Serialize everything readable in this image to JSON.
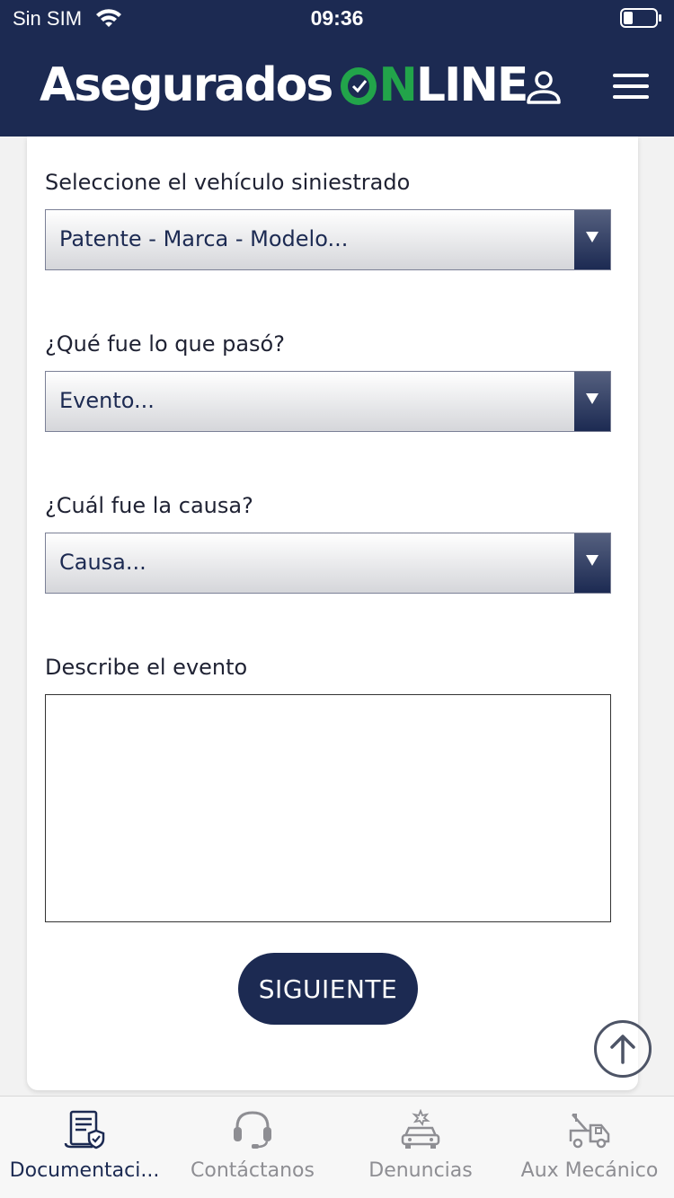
{
  "status_bar": {
    "carrier": "Sin SIM",
    "time": "09:36"
  },
  "header": {
    "logo": {
      "part1": "Asegurados",
      "part2_on": "N",
      "part3": "LINE"
    }
  },
  "form": {
    "vehicle": {
      "label": "Seleccione el vehículo siniestrado",
      "selected": "Patente - Marca - Modelo..."
    },
    "event": {
      "label": "¿Qué fue lo que pasó?",
      "selected": "Evento..."
    },
    "cause": {
      "label": "¿Cuál fue la causa?",
      "selected": "Causa..."
    },
    "description": {
      "label": "Describe el evento",
      "value": ""
    },
    "next_label": "SIGUIENTE"
  },
  "tabs": [
    {
      "label": "Documentaci...",
      "icon": "document-shield-icon",
      "active": true
    },
    {
      "label": "Contáctanos",
      "icon": "headset-icon",
      "active": false
    },
    {
      "label": "Denuncias",
      "icon": "car-crash-icon",
      "active": false
    },
    {
      "label": "Aux Mecánico",
      "icon": "tow-truck-icon",
      "active": false
    }
  ],
  "colors": {
    "navy": "#1c2a52",
    "green": "#22a44a",
    "inactive": "#8e8e93"
  }
}
